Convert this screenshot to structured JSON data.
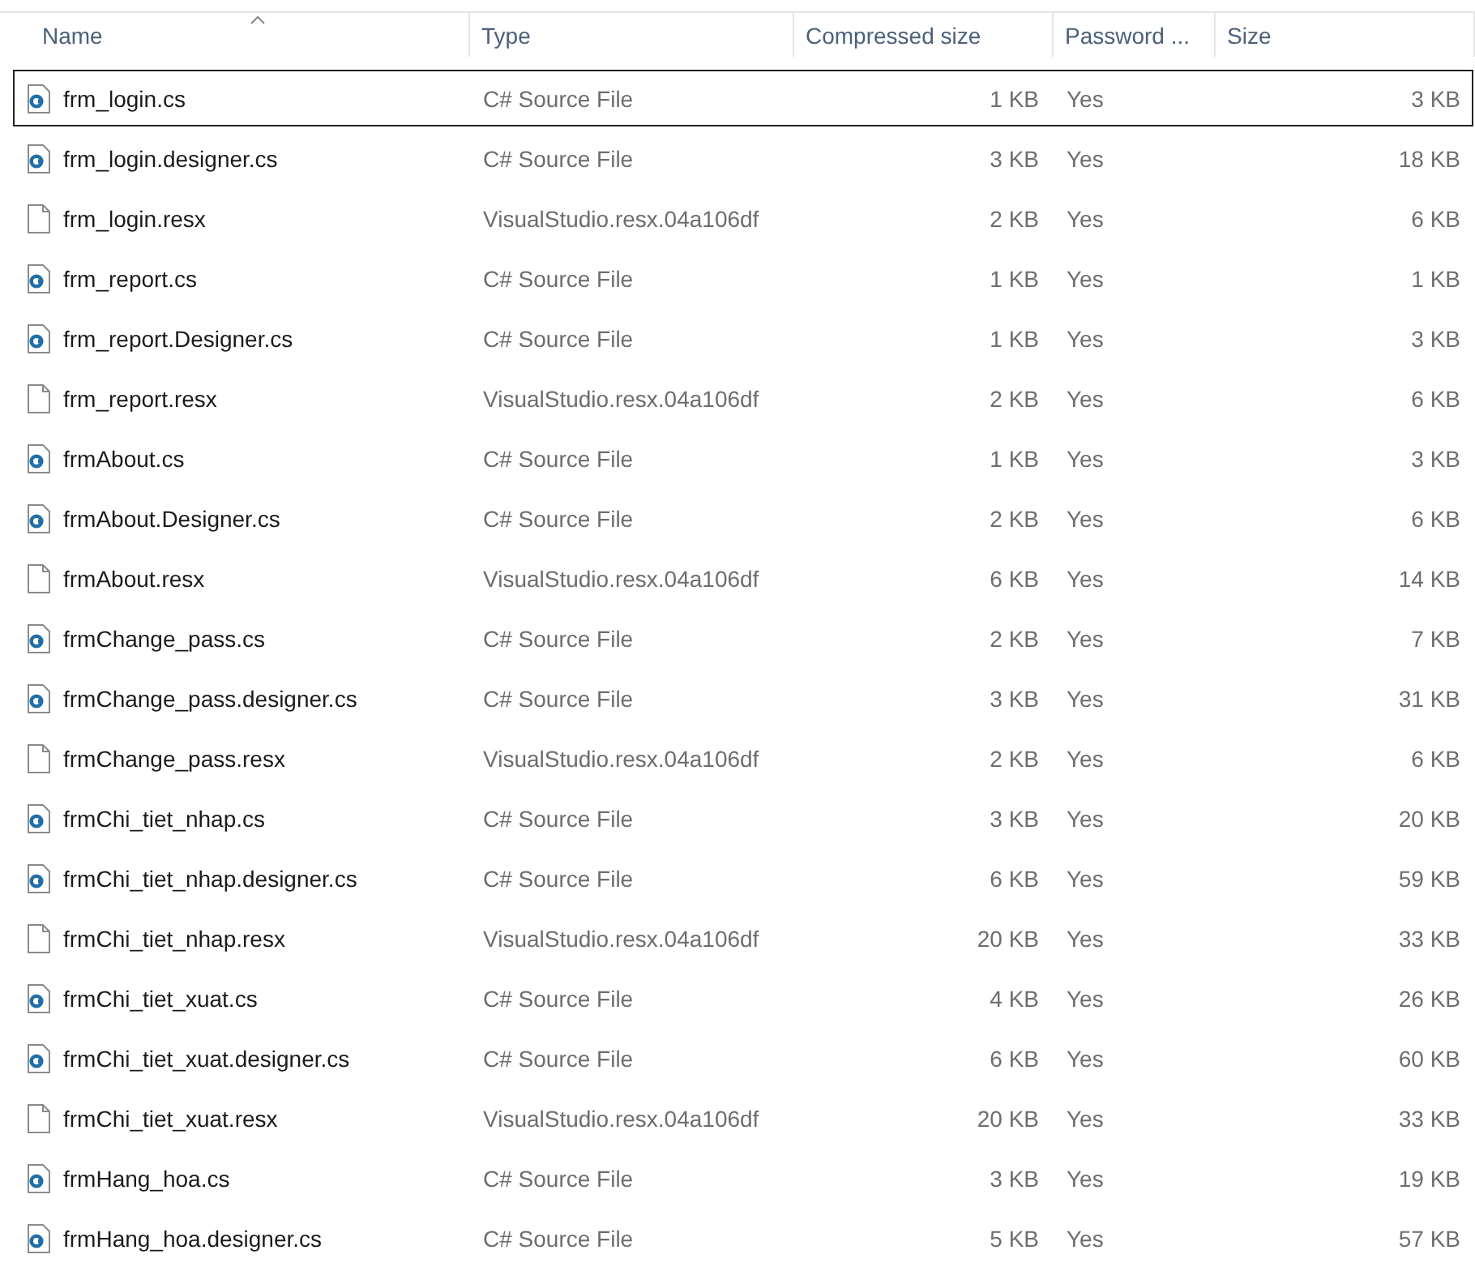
{
  "table": {
    "columns": [
      {
        "label": "Name",
        "sorted": true
      },
      {
        "label": "Type",
        "sorted": false
      },
      {
        "label": "Compressed size",
        "sorted": false
      },
      {
        "label": "Password ...",
        "sorted": false
      },
      {
        "label": "Size",
        "sorted": false
      }
    ],
    "rows": [
      {
        "kind": "cs",
        "name": "frm_login.cs",
        "type": "C# Source File",
        "compressed": "1 KB",
        "password": "Yes",
        "size": "3 KB",
        "focused": true
      },
      {
        "kind": "cs",
        "name": "frm_login.designer.cs",
        "type": "C# Source File",
        "compressed": "3 KB",
        "password": "Yes",
        "size": "18 KB",
        "focused": false
      },
      {
        "kind": "resx",
        "name": "frm_login.resx",
        "type": "VisualStudio.resx.04a106df",
        "compressed": "2 KB",
        "password": "Yes",
        "size": "6 KB",
        "focused": false
      },
      {
        "kind": "cs",
        "name": "frm_report.cs",
        "type": "C# Source File",
        "compressed": "1 KB",
        "password": "Yes",
        "size": "1 KB",
        "focused": false
      },
      {
        "kind": "cs",
        "name": "frm_report.Designer.cs",
        "type": "C# Source File",
        "compressed": "1 KB",
        "password": "Yes",
        "size": "3 KB",
        "focused": false
      },
      {
        "kind": "resx",
        "name": "frm_report.resx",
        "type": "VisualStudio.resx.04a106df",
        "compressed": "2 KB",
        "password": "Yes",
        "size": "6 KB",
        "focused": false
      },
      {
        "kind": "cs",
        "name": "frmAbout.cs",
        "type": "C# Source File",
        "compressed": "1 KB",
        "password": "Yes",
        "size": "3 KB",
        "focused": false
      },
      {
        "kind": "cs",
        "name": "frmAbout.Designer.cs",
        "type": "C# Source File",
        "compressed": "2 KB",
        "password": "Yes",
        "size": "6 KB",
        "focused": false
      },
      {
        "kind": "resx",
        "name": "frmAbout.resx",
        "type": "VisualStudio.resx.04a106df",
        "compressed": "6 KB",
        "password": "Yes",
        "size": "14 KB",
        "focused": false
      },
      {
        "kind": "cs",
        "name": "frmChange_pass.cs",
        "type": "C# Source File",
        "compressed": "2 KB",
        "password": "Yes",
        "size": "7 KB",
        "focused": false
      },
      {
        "kind": "cs",
        "name": "frmChange_pass.designer.cs",
        "type": "C# Source File",
        "compressed": "3 KB",
        "password": "Yes",
        "size": "31 KB",
        "focused": false
      },
      {
        "kind": "resx",
        "name": "frmChange_pass.resx",
        "type": "VisualStudio.resx.04a106df",
        "compressed": "2 KB",
        "password": "Yes",
        "size": "6 KB",
        "focused": false
      },
      {
        "kind": "cs",
        "name": "frmChi_tiet_nhap.cs",
        "type": "C# Source File",
        "compressed": "3 KB",
        "password": "Yes",
        "size": "20 KB",
        "focused": false
      },
      {
        "kind": "cs",
        "name": "frmChi_tiet_nhap.designer.cs",
        "type": "C# Source File",
        "compressed": "6 KB",
        "password": "Yes",
        "size": "59 KB",
        "focused": false
      },
      {
        "kind": "resx",
        "name": "frmChi_tiet_nhap.resx",
        "type": "VisualStudio.resx.04a106df",
        "compressed": "20 KB",
        "password": "Yes",
        "size": "33 KB",
        "focused": false
      },
      {
        "kind": "cs",
        "name": "frmChi_tiet_xuat.cs",
        "type": "C# Source File",
        "compressed": "4 KB",
        "password": "Yes",
        "size": "26 KB",
        "focused": false
      },
      {
        "kind": "cs",
        "name": "frmChi_tiet_xuat.designer.cs",
        "type": "C# Source File",
        "compressed": "6 KB",
        "password": "Yes",
        "size": "60 KB",
        "focused": false
      },
      {
        "kind": "resx",
        "name": "frmChi_tiet_xuat.resx",
        "type": "VisualStudio.resx.04a106df",
        "compressed": "20 KB",
        "password": "Yes",
        "size": "33 KB",
        "focused": false
      },
      {
        "kind": "cs",
        "name": "frmHang_hoa.cs",
        "type": "C# Source File",
        "compressed": "3 KB",
        "password": "Yes",
        "size": "19 KB",
        "focused": false
      },
      {
        "kind": "cs",
        "name": "frmHang_hoa.designer.cs",
        "type": "C# Source File",
        "compressed": "5 KB",
        "password": "Yes",
        "size": "57 KB",
        "focused": false
      }
    ]
  }
}
